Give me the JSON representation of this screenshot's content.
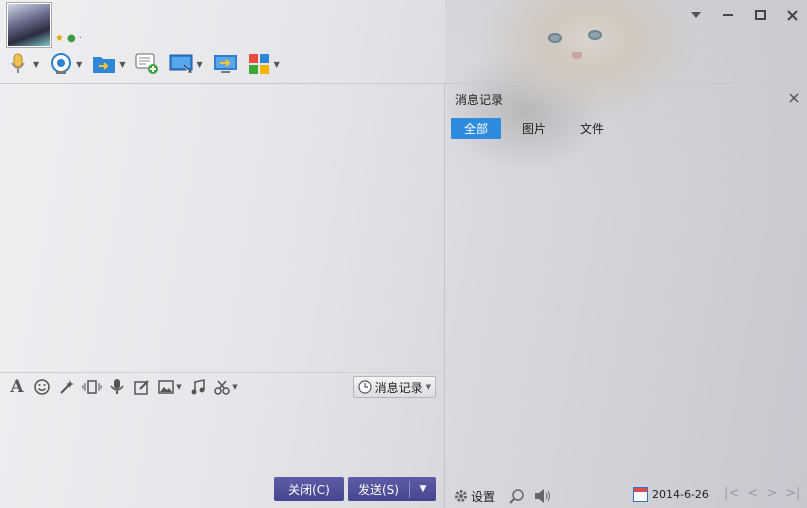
{
  "window": {
    "controls": [
      "chevron-down-icon",
      "minimize-icon",
      "maximize-icon",
      "close-icon"
    ]
  },
  "toolbar": {
    "items": [
      {
        "icon": "microphone-icon",
        "has_dropdown": true
      },
      {
        "icon": "webcam-icon",
        "has_dropdown": true
      },
      {
        "icon": "send-file-icon",
        "has_dropdown": true
      },
      {
        "icon": "add-chat-icon",
        "has_dropdown": false
      },
      {
        "icon": "remote-desktop-icon",
        "has_dropdown": true
      },
      {
        "icon": "share-screen-icon",
        "has_dropdown": false
      },
      {
        "icon": "apps-icon",
        "has_dropdown": true
      }
    ]
  },
  "input_toolbar": {
    "icons": [
      "font-icon",
      "emoji-icon",
      "magic-icon",
      "shake-icon",
      "voice-icon",
      "edit-icon",
      "image-icon",
      "music-icon",
      "scissors-icon"
    ],
    "history_label": "消息记录"
  },
  "buttons": {
    "close_label": "关闭(C)",
    "send_label": "发送(S)"
  },
  "history_panel": {
    "title": "消息记录",
    "tabs": [
      {
        "label": "全部",
        "active": true
      },
      {
        "label": "图片",
        "active": false
      },
      {
        "label": "文件",
        "active": false
      }
    ],
    "footer": {
      "settings_label": "设置",
      "date": "2014-6-26"
    }
  },
  "colors": {
    "accent": "#2d8cde",
    "button": "#4d4d99"
  }
}
